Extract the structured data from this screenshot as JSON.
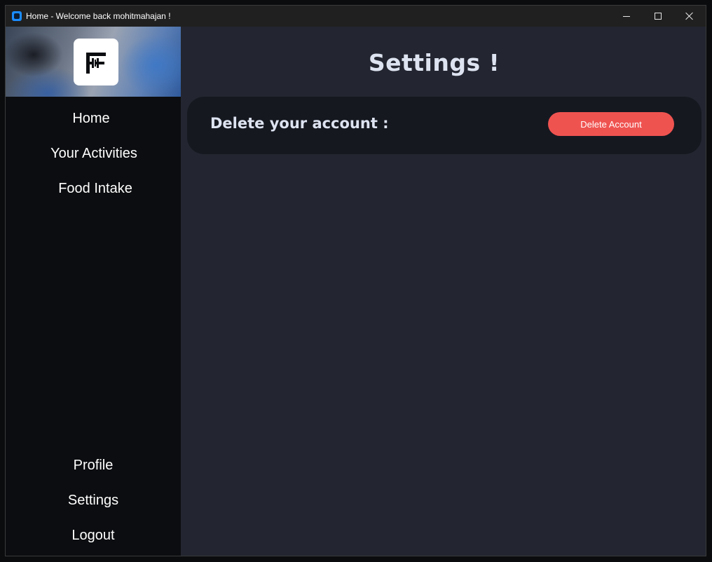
{
  "window": {
    "title": "Home - Welcome back mohitmahajan !",
    "controls": {
      "minimize_icon": "minimize-icon",
      "maximize_icon": "maximize-icon",
      "close_icon": "close-icon"
    }
  },
  "sidebar": {
    "logo_icon": "fitness-f-logo",
    "top_items": [
      {
        "label": "Home"
      },
      {
        "label": "Your Activities"
      },
      {
        "label": "Food Intake"
      }
    ],
    "bottom_items": [
      {
        "label": "Profile"
      },
      {
        "label": "Settings"
      },
      {
        "label": "Logout"
      }
    ]
  },
  "main": {
    "title": "Settings !",
    "delete_card": {
      "label": "Delete your account :",
      "button_label": "Delete Account"
    }
  },
  "colors": {
    "sidebar_bg": "#0c0d10",
    "main_bg": "#232630",
    "card_bg": "#161820",
    "danger": "#ef5350",
    "heading_text": "#dde3f0",
    "titlebar_bg": "#202020",
    "app_icon_accent": "#1a8cff"
  }
}
